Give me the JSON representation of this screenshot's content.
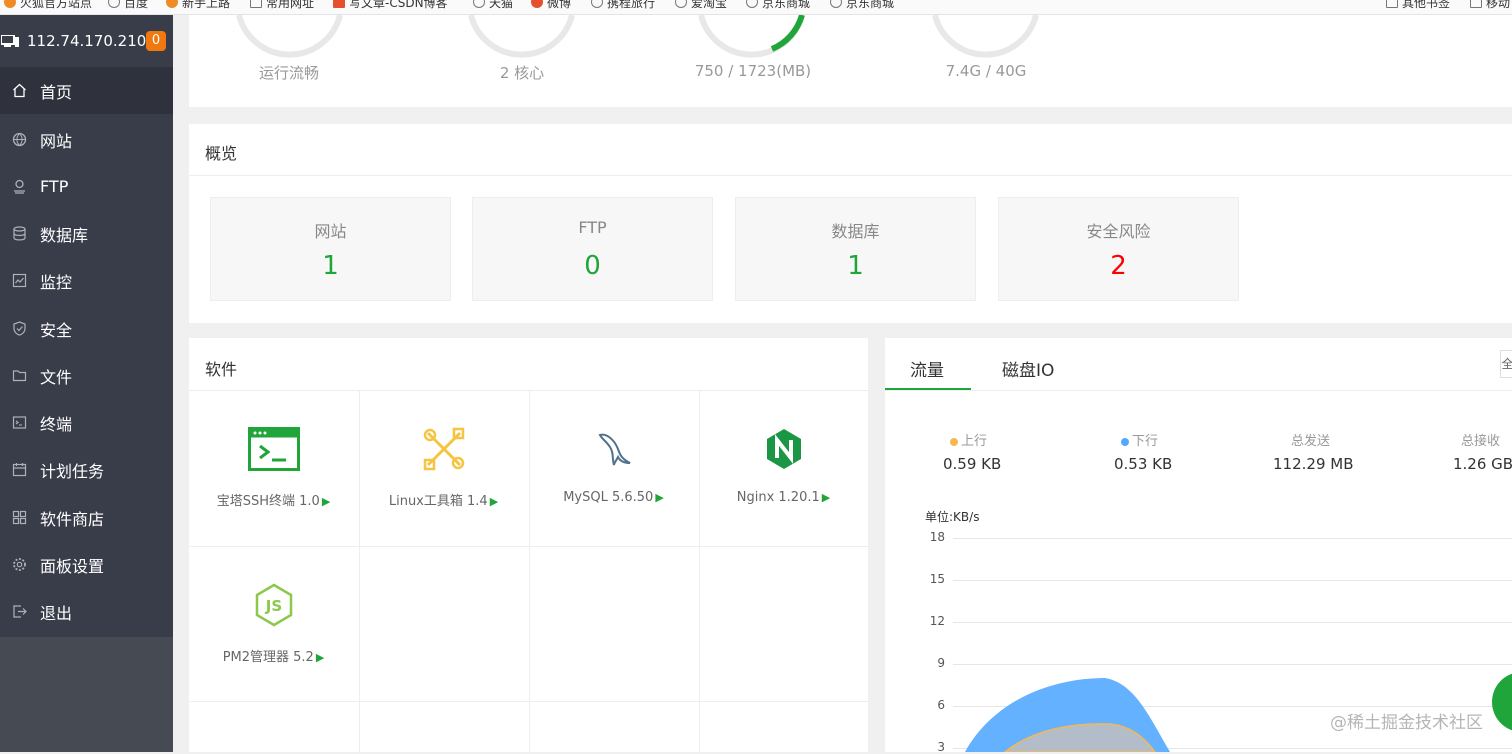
{
  "bookmarks": [
    "火狐官方站点",
    "百度",
    "新手上路",
    "常用网址",
    "写文章-CSDN博客",
    "天猫",
    "微博",
    "携程旅行",
    "爱淘宝",
    "京东商城",
    "京东商城",
    "其他书签",
    "移动"
  ],
  "server": {
    "ip": "112.74.170.210",
    "badge": "0"
  },
  "sidebar": {
    "items": [
      {
        "label": "首页",
        "icon": "home-icon"
      },
      {
        "label": "网站",
        "icon": "globe-icon"
      },
      {
        "label": "FTP",
        "icon": "ftp-icon"
      },
      {
        "label": "数据库",
        "icon": "database-icon"
      },
      {
        "label": "监控",
        "icon": "monitor-icon"
      },
      {
        "label": "安全",
        "icon": "shield-icon"
      },
      {
        "label": "文件",
        "icon": "folder-icon"
      },
      {
        "label": "终端",
        "icon": "terminal-icon"
      },
      {
        "label": "计划任务",
        "icon": "calendar-icon"
      },
      {
        "label": "软件商店",
        "icon": "grid-icon"
      },
      {
        "label": "面板设置",
        "icon": "gear-icon"
      },
      {
        "label": "退出",
        "icon": "logout-icon"
      }
    ]
  },
  "gauges": [
    {
      "text": "运行流畅"
    },
    {
      "text": "2 核心"
    },
    {
      "text": "750 / 1723(MB)",
      "fill": 0.435
    },
    {
      "text": "7.4G / 40G"
    }
  ],
  "overview": {
    "title": "概览",
    "boxes": [
      {
        "label": "网站",
        "value": "1"
      },
      {
        "label": "FTP",
        "value": "0"
      },
      {
        "label": "数据库",
        "value": "1"
      },
      {
        "label": "安全风险",
        "value": "2"
      }
    ]
  },
  "software": {
    "title": "软件",
    "items": [
      {
        "name": "宝塔SSH终端 1.0",
        "icon": "ssh-terminal-icon"
      },
      {
        "name": "Linux工具箱 1.4",
        "icon": "toolbox-icon"
      },
      {
        "name": "MySQL 5.6.50",
        "icon": "mysql-dolphin-icon"
      },
      {
        "name": "Nginx 1.20.1",
        "icon": "nginx-icon"
      },
      {
        "name": "PM2管理器 5.2",
        "icon": "nodejs-icon"
      }
    ],
    "arrow": "▶"
  },
  "traffic": {
    "tabs": [
      "流量",
      "磁盘IO"
    ],
    "right_button": "全",
    "stats": [
      {
        "label": "上行",
        "value": "0.59 KB",
        "color": "#f7b851"
      },
      {
        "label": "下行",
        "value": "0.53 KB",
        "color": "#52a9ff"
      },
      {
        "label": "总发送",
        "value": "112.29 MB"
      },
      {
        "label": "总接收",
        "value": "1.26 GB"
      }
    ],
    "unit": "单位:KB/s",
    "yticks": [
      "18",
      "15",
      "12",
      "9",
      "6",
      "3"
    ]
  },
  "chart_data": {
    "type": "area",
    "ylabel": "单位:KB/s",
    "ylim": [
      0,
      18
    ],
    "series": [
      {
        "name": "下行",
        "color": "#52a9ff"
      },
      {
        "name": "上行",
        "color": "#f7b851"
      }
    ],
    "peaks": {
      "下行": 8.1,
      "上行": 4.7
    }
  },
  "watermark": "@稀土掘金技术社区"
}
